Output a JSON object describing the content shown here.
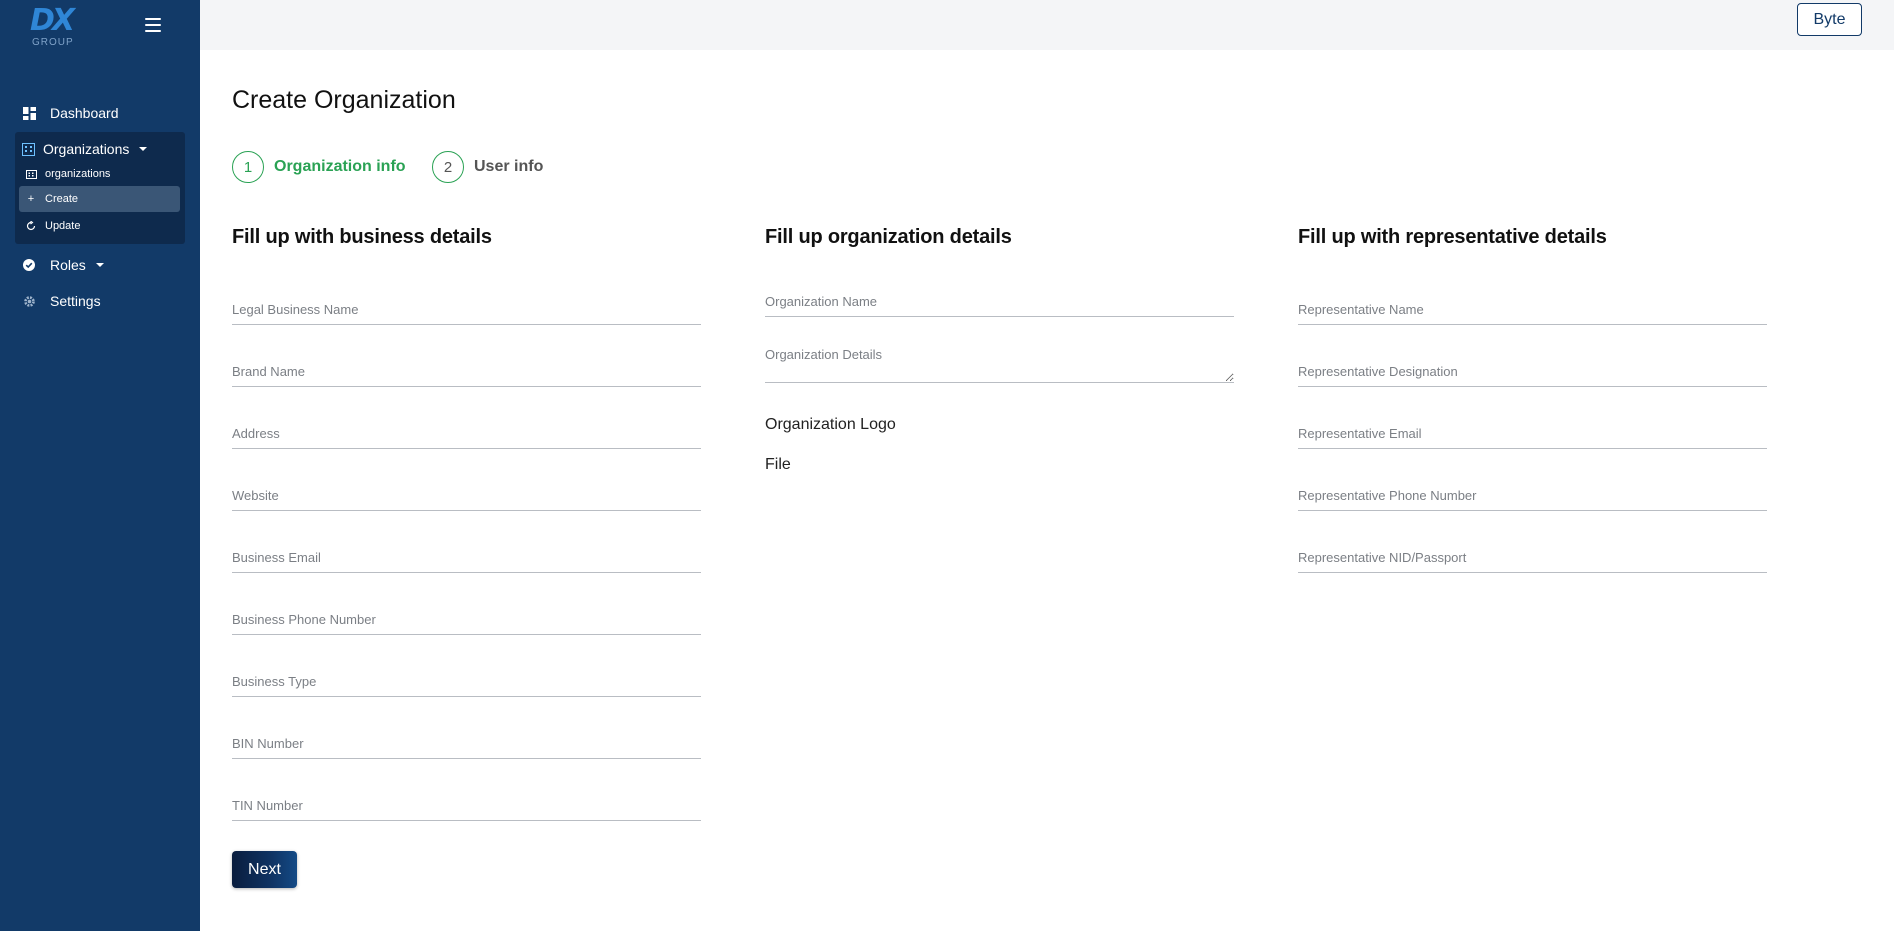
{
  "brand": {
    "logo_text": "DX",
    "logo_sub": "GROUP"
  },
  "sidebar": {
    "dashboard": "Dashboard",
    "organizations": "Organizations",
    "org_items": [
      {
        "label": "organizations"
      },
      {
        "label": "Create"
      },
      {
        "label": "Update"
      }
    ],
    "roles": "Roles",
    "settings": "Settings"
  },
  "topbar": {
    "user_button": "Byte"
  },
  "page": {
    "title": "Create Organization",
    "steps": [
      {
        "number": "1",
        "label": "Organization info"
      },
      {
        "number": "2",
        "label": "User info"
      }
    ]
  },
  "business": {
    "heading": "Fill up with business details",
    "fields": [
      {
        "placeholder": "Legal Business Name",
        "value": ""
      },
      {
        "placeholder": "Brand Name",
        "value": ""
      },
      {
        "placeholder": "Address",
        "value": ""
      },
      {
        "placeholder": "Website",
        "value": ""
      },
      {
        "placeholder": "Business Email",
        "value": ""
      },
      {
        "placeholder": "Business Phone Number",
        "value": ""
      },
      {
        "placeholder": "Business Type",
        "value": ""
      },
      {
        "placeholder": "BIN Number",
        "value": ""
      },
      {
        "placeholder": "TIN Number",
        "value": ""
      }
    ]
  },
  "organization": {
    "heading": "Fill up organization details",
    "name_placeholder": "Organization Name",
    "details_placeholder": "Organization Details",
    "logo_label": "Organization Logo",
    "file_label": "File"
  },
  "representative": {
    "heading": "Fill up with representative details",
    "fields": [
      {
        "placeholder": "Representative Name",
        "value": ""
      },
      {
        "placeholder": "Representative Designation",
        "value": ""
      },
      {
        "placeholder": "Representative Email",
        "value": ""
      },
      {
        "placeholder": "Representative Phone Number",
        "value": ""
      },
      {
        "placeholder": "Representative NID/Passport",
        "value": ""
      }
    ]
  },
  "actions": {
    "next_label": "Next"
  },
  "colors": {
    "sidebar": "#123a68",
    "accent_green": "#2aa254",
    "topbar": "#f4f5f7"
  }
}
